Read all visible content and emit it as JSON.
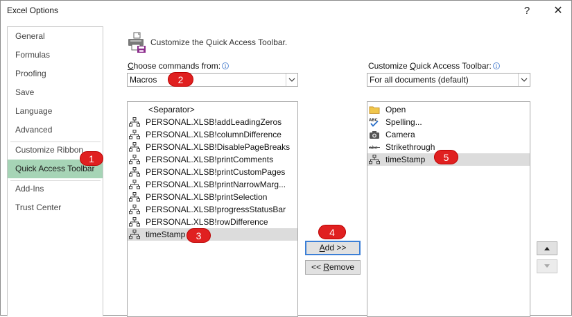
{
  "window": {
    "title": "Excel Options",
    "help_glyph": "?",
    "close_glyph": "✕"
  },
  "sidebar": {
    "items": [
      {
        "label": "General"
      },
      {
        "label": "Formulas"
      },
      {
        "label": "Proofing"
      },
      {
        "label": "Save"
      },
      {
        "label": "Language"
      },
      {
        "label": "Advanced"
      },
      {
        "label": "Customize Ribbon"
      },
      {
        "label": "Quick Access Toolbar",
        "active": true
      },
      {
        "label": "Add-Ins"
      },
      {
        "label": "Trust Center"
      }
    ]
  },
  "header": {
    "text": "Customize the Quick Access Toolbar.",
    "icon": "quick-access-toolbar-icon"
  },
  "left": {
    "label_prefix": "",
    "label_access": "C",
    "label_rest": "hoose commands from:",
    "combo_value": "Macros",
    "commands": [
      {
        "label": "<Separator>",
        "icon": "none"
      },
      {
        "label": "PERSONAL.XLSB!addLeadingZeros",
        "icon": "macro-icon"
      },
      {
        "label": "PERSONAL.XLSB!columnDifference",
        "icon": "macro-icon"
      },
      {
        "label": "PERSONAL.XLSB!DisablePageBreaks",
        "icon": "macro-icon"
      },
      {
        "label": "PERSONAL.XLSB!printComments",
        "icon": "macro-icon"
      },
      {
        "label": "PERSONAL.XLSB!printCustomPages",
        "icon": "macro-icon"
      },
      {
        "label": "PERSONAL.XLSB!printNarrowMarg...",
        "icon": "macro-icon"
      },
      {
        "label": "PERSONAL.XLSB!printSelection",
        "icon": "macro-icon"
      },
      {
        "label": "PERSONAL.XLSB!progressStatusBar",
        "icon": "macro-icon"
      },
      {
        "label": "PERSONAL.XLSB!rowDifference",
        "icon": "macro-icon"
      },
      {
        "label": "timeStamp",
        "icon": "macro-icon",
        "selected": true
      }
    ]
  },
  "middle": {
    "add_prefix": "",
    "add_access": "A",
    "add_rest": "dd >>",
    "remove_prefix": "<< ",
    "remove_access": "R",
    "remove_rest": "emove"
  },
  "right": {
    "label_prefix": "Customize ",
    "label_access": "Q",
    "label_rest": "uick Access Toolbar:",
    "combo_value": "For all documents (default)",
    "items": [
      {
        "label": "Open",
        "icon": "folder-icon"
      },
      {
        "label": "Spelling...",
        "icon": "spelling-check-icon"
      },
      {
        "label": "Camera",
        "icon": "camera-icon"
      },
      {
        "label": "Strikethrough",
        "icon": "strikethrough-icon"
      },
      {
        "label": "timeStamp",
        "icon": "macro-icon",
        "selected": true
      }
    ]
  },
  "badges": [
    "1",
    "2",
    "3",
    "4",
    "5"
  ],
  "colors": {
    "sidebar_active": "#a6d4b6",
    "badge": "#e02020",
    "selection": "#dcdcdc"
  }
}
